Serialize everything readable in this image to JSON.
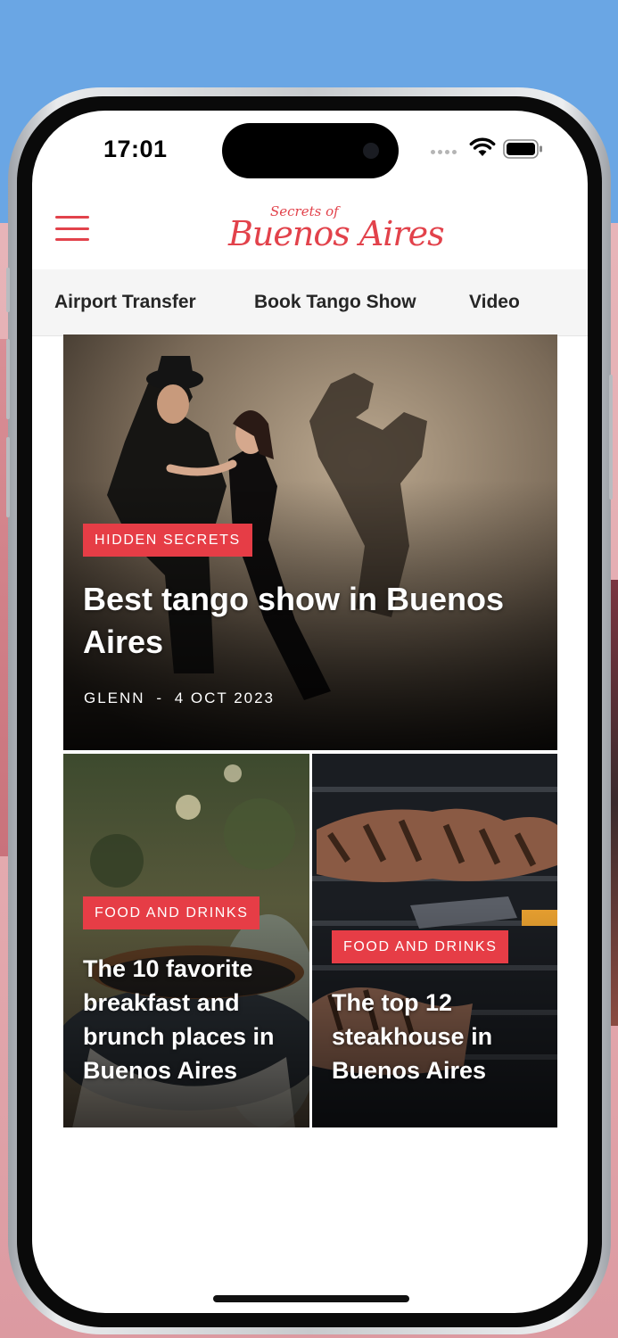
{
  "status_bar": {
    "time": "17:01"
  },
  "header": {
    "logo_small": "Secrets of",
    "logo_big": "Buenos Aires"
  },
  "nav": {
    "items": [
      {
        "label": "Airport Transfer"
      },
      {
        "label": "Book Tango Show"
      },
      {
        "label": "Video"
      }
    ]
  },
  "featured": {
    "category": "HIDDEN SECRETS",
    "title": "Best tango show in Buenos Aires",
    "author": "GLENN",
    "separator": "-",
    "date": "4 OCT 2023"
  },
  "articles": [
    {
      "category": "FOOD AND DRINKS",
      "title": "The 10 favorite breakfast and brunch places in Buenos Aires"
    },
    {
      "category": "FOOD AND DRINKS",
      "title": "The top 12 steakhouse in Buenos Aires"
    }
  ],
  "colors": {
    "brand": "#e2424b",
    "badge": "#e63d46",
    "background": "#6aa6e4"
  },
  "icons": [
    "hamburger-menu-icon",
    "wifi-icon",
    "battery-icon",
    "cellular-signal-icon"
  ]
}
